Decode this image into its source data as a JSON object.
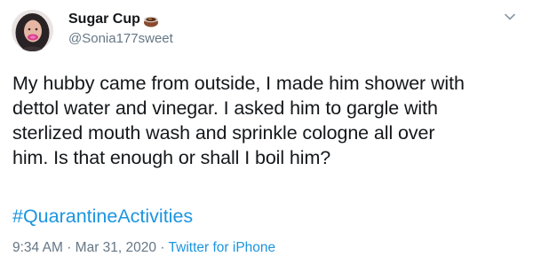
{
  "user": {
    "display_name": "Sugar Cup",
    "handle": "@Sonia177sweet",
    "avatar_icon": "profile-photo",
    "name_emoji_icon": "coffee-cup-icon"
  },
  "tweet": {
    "text_lines": [
      "My hubby came from outside, I made him shower with",
      "dettol water and vinegar. I asked him to gargle with",
      "sterlized mouth wash and sprinkle cologne all over",
      "him. Is that enough or shall I boil him?"
    ],
    "hashtag": "#QuarantineActivities",
    "time": "9:34 AM",
    "separator": "·",
    "date": "Mar 31, 2020",
    "source": "Twitter for iPhone"
  },
  "colors": {
    "text": "#14171a",
    "secondary": "#657786",
    "link": "#1b95e0"
  },
  "menu": {
    "icon": "chevron-down-icon"
  }
}
